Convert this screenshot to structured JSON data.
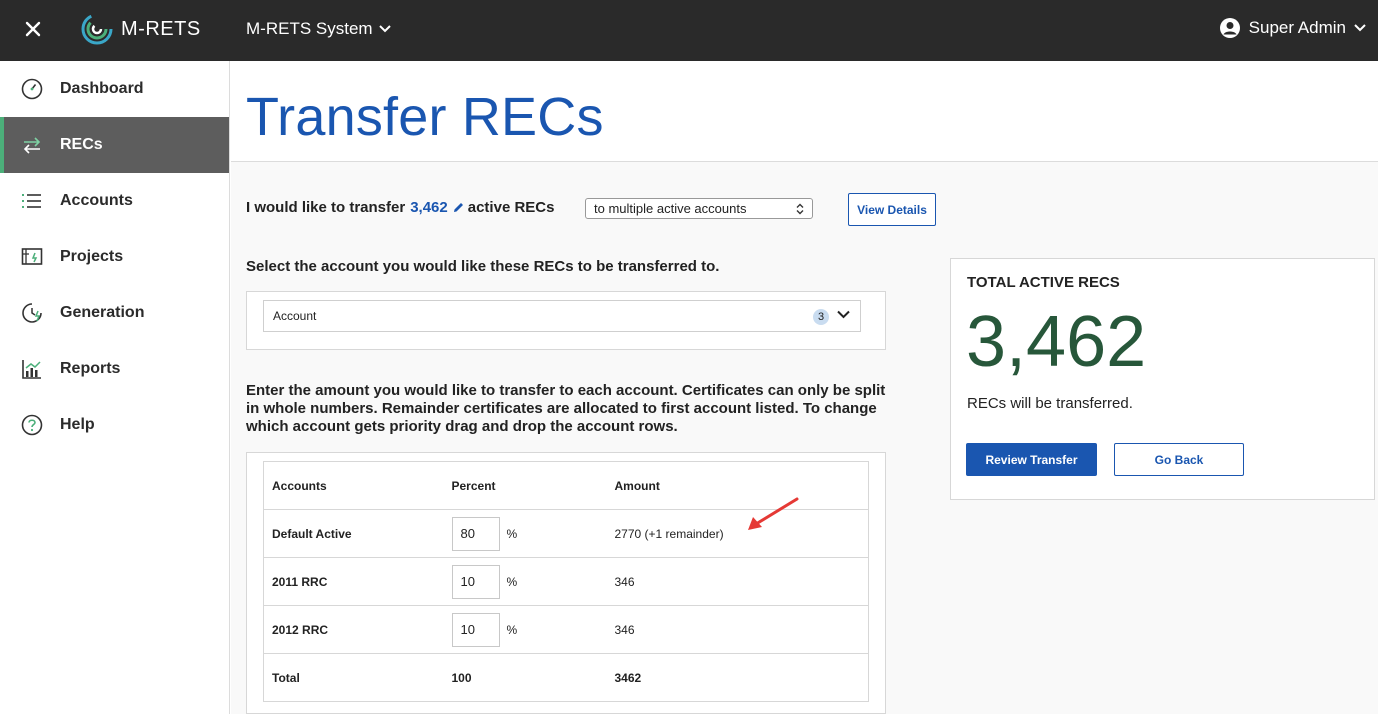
{
  "topbar": {
    "brand": "M-RETS",
    "system_label": "M-RETS System",
    "user_label": "Super Admin"
  },
  "sidebar": {
    "items": [
      {
        "label": "Dashboard",
        "icon": "speedometer-icon",
        "active": false
      },
      {
        "label": "RECs",
        "icon": "transfer-arrows-icon",
        "active": true
      },
      {
        "label": "Accounts",
        "icon": "list-icon",
        "active": false
      },
      {
        "label": "Projects",
        "icon": "solar-panel-icon",
        "active": false
      },
      {
        "label": "Generation",
        "icon": "clock-bolt-icon",
        "active": false
      },
      {
        "label": "Reports",
        "icon": "bar-chart-icon",
        "active": false
      },
      {
        "label": "Help",
        "icon": "question-circle-icon",
        "active": false
      }
    ]
  },
  "page": {
    "title": "Transfer RECs"
  },
  "transfer": {
    "prefix": "I would like to transfer",
    "amount": "3,462",
    "suffix": "active RECs",
    "mode_selected": "to multiple active accounts",
    "view_details": "View Details"
  },
  "account_select": {
    "label": "Select the account you would like these RECs to be transferred to.",
    "placeholder": "Account",
    "count": "3"
  },
  "instructions": "Enter the amount you would like to transfer to each account. Certificates can only be split in whole numbers. Remainder certificates are allocated to first account listed. To change which account gets priority drag and drop the account rows.",
  "table": {
    "headers": {
      "accounts": "Accounts",
      "percent": "Percent",
      "amount": "Amount"
    },
    "rows": [
      {
        "account": "Default Active",
        "percent": "80",
        "amount": "2770 (+1 remainder)"
      },
      {
        "account": "2011 RRC",
        "percent": "10",
        "amount": "346"
      },
      {
        "account": "2012 RRC",
        "percent": "10",
        "amount": "346"
      }
    ],
    "percent_sign": "%",
    "total": {
      "label": "Total",
      "percent": "100",
      "amount": "3462"
    }
  },
  "summary": {
    "title": "TOTAL ACTIVE RECS",
    "value": "3,462",
    "subtitle": "RECs will be transferred.",
    "review_button": "Review Transfer",
    "back_button": "Go Back"
  },
  "colors": {
    "topbar": "#2a2a2a",
    "brand_blue": "#1a56b0",
    "active_nav": "#5d5d5d",
    "active_indicator": "#4caf7a",
    "total_green": "#27573a",
    "annotation_arrow": "#e53935"
  }
}
